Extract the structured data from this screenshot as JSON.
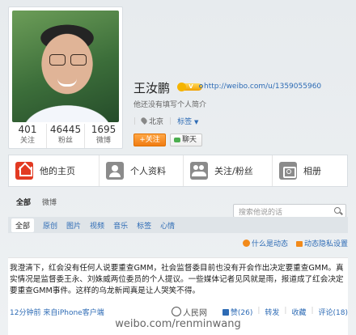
{
  "profile": {
    "name": "王汝鹏",
    "verified_badge": "V",
    "home_link": "http://weibo.com/u/1359055960",
    "bio": "他还没有填写个人简介",
    "location": "北京",
    "tags_label": "标签",
    "follow_button": "+关注",
    "chat_button": "聊天",
    "stats": [
      {
        "value": "401",
        "label": "关注"
      },
      {
        "value": "46445",
        "label": "粉丝"
      },
      {
        "value": "1695",
        "label": "微博"
      }
    ]
  },
  "tabs": [
    {
      "label": "他的主页",
      "icon": "home-icon"
    },
    {
      "label": "个人资料",
      "icon": "profile-icon"
    },
    {
      "label": "关注/粉丝",
      "icon": "follow-icon"
    },
    {
      "label": "相册",
      "icon": "album-icon"
    }
  ],
  "filter_primary": [
    "全部",
    "微博"
  ],
  "search": {
    "placeholder": "搜索他说的话"
  },
  "filter_secondary": [
    "全部",
    "原创",
    "图片",
    "视频",
    "音乐",
    "标签",
    "心情"
  ],
  "feed_links": {
    "what_is_feed": "什么是动态",
    "privacy": "动态隐私设置"
  },
  "post": {
    "text": "我澄清下，红会没有任何人说要重查GMM，社会监督委目前也没有开会作出决定要重查GMM。真实情况是监督委王永、刘姝威两位委员的个人提议。一些媒体记者见风就是雨，报道成了红会决定要重查GMM事件。这样的乌龙新闻真是让人哭笑不得。",
    "time_source": "12分钟前 来自iPhone客户端",
    "like": "赞(26)",
    "forward": "转发",
    "favorite": "收藏",
    "comment": "评论(18)"
  },
  "watermark": {
    "logo_text": "人民网",
    "url": "weibo.com/renminwang"
  },
  "colors": {
    "accent": "#e23a22",
    "link": "#2d6bb5",
    "follow": "#f07c12"
  }
}
